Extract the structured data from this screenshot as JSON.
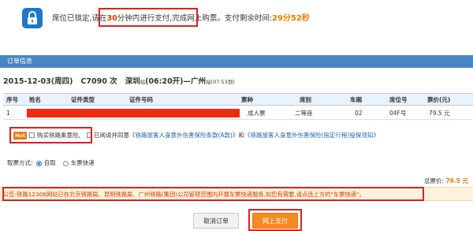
{
  "notice": {
    "part1": "席位已锁定,",
    "part2": "请在",
    "minutes": "30",
    "part3": "分钟内进行支付,",
    "part4": "完成网上购票。支付剩余时间:",
    "countdown": "29分52秒"
  },
  "section": {
    "title": "订单信息"
  },
  "trip": {
    "date": "2015-12-03",
    "weekday": "(周四)",
    "train": "C7090 次",
    "from": "深圳",
    "from_suffix": "站",
    "depart": "(06:20开)",
    "dash": "—",
    "to": "广州",
    "to_suffix": "站",
    "arrive": "(07:53到)"
  },
  "table": {
    "headers": [
      "序号",
      "姓名",
      "证件类型",
      "证件号码",
      "票种",
      "席别",
      "车厢",
      "席位号",
      "票价(元)"
    ],
    "row": {
      "index": "1",
      "ticket_type": "成人票",
      "seat_class": "二等座",
      "carriage": "02",
      "seat_no": "04F号",
      "price": "79.5 元"
    }
  },
  "insurance": {
    "badge": "Hot",
    "label": "购买铁路乘意险,",
    "agree": "已阅读并同意",
    "link1": "《铁路旅客人身意外伤害保险条款(A款)》",
    "and": "和",
    "link2": "《铁路旅客人身意外伤害保险(指定行程)投保须知》"
  },
  "pickup": {
    "label": "取票方式:",
    "option1": "自取",
    "option2": "车票快递",
    "selected": "自取"
  },
  "total": {
    "label": "总票价:",
    "amount": "79.5 元"
  },
  "announcement": {
    "text": "公告:铁路12306网站已在北京铁路局、昆明铁路局、广州铁路(集团)公司管辖范围内开展车票快递服务,如您有需要,请点选上方的\"车票快递\"。"
  },
  "buttons": {
    "cancel": "取消订单",
    "pay": "网上支付"
  },
  "colors": {
    "accent": "#4a86c6",
    "warn": "#e03a00",
    "pay": "#f58a1f",
    "highlight": "#e02020"
  },
  "icons": {
    "lock": "lock-icon"
  }
}
